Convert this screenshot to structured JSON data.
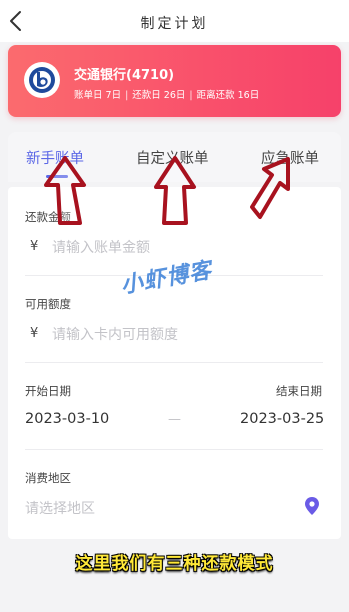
{
  "header": {
    "title": "制定计划",
    "back_icon": "chevron-left-icon"
  },
  "bank_card": {
    "name": "交通银行(4710)",
    "billing_day": "账单日 7日",
    "repay_day": "还款日 26日",
    "days_until_repay": "距离还款 16日",
    "separator": "|",
    "logo_icon": "bank-logo-icon",
    "gradient_colors": [
      "#fb6b6e",
      "#f6416a"
    ]
  },
  "tabs": [
    {
      "label": "新手账单",
      "active": true
    },
    {
      "label": "自定义账单",
      "active": false
    },
    {
      "label": "应急账单",
      "active": false
    }
  ],
  "form": {
    "bill_amount": {
      "label": "还款金额",
      "currency": "¥",
      "placeholder": "请输入账单金额"
    },
    "available_limit": {
      "label": "可用额度",
      "currency": "¥",
      "placeholder": "请输入卡内可用额度"
    },
    "start_date": {
      "label": "开始日期",
      "value": "2023-03-10"
    },
    "end_date": {
      "label": "结束日期",
      "value": "2023-03-25"
    },
    "date_separator": "—",
    "region": {
      "label": "消费地区",
      "placeholder": "请选择地区",
      "icon": "location-pin-icon"
    }
  },
  "overlay": {
    "watermark": "小虾博客",
    "caption": "这里我们有三种还款模式",
    "arrow_color": "#a8121f"
  },
  "colors": {
    "accent": "#5b67e6",
    "caption": "#ffe838"
  }
}
